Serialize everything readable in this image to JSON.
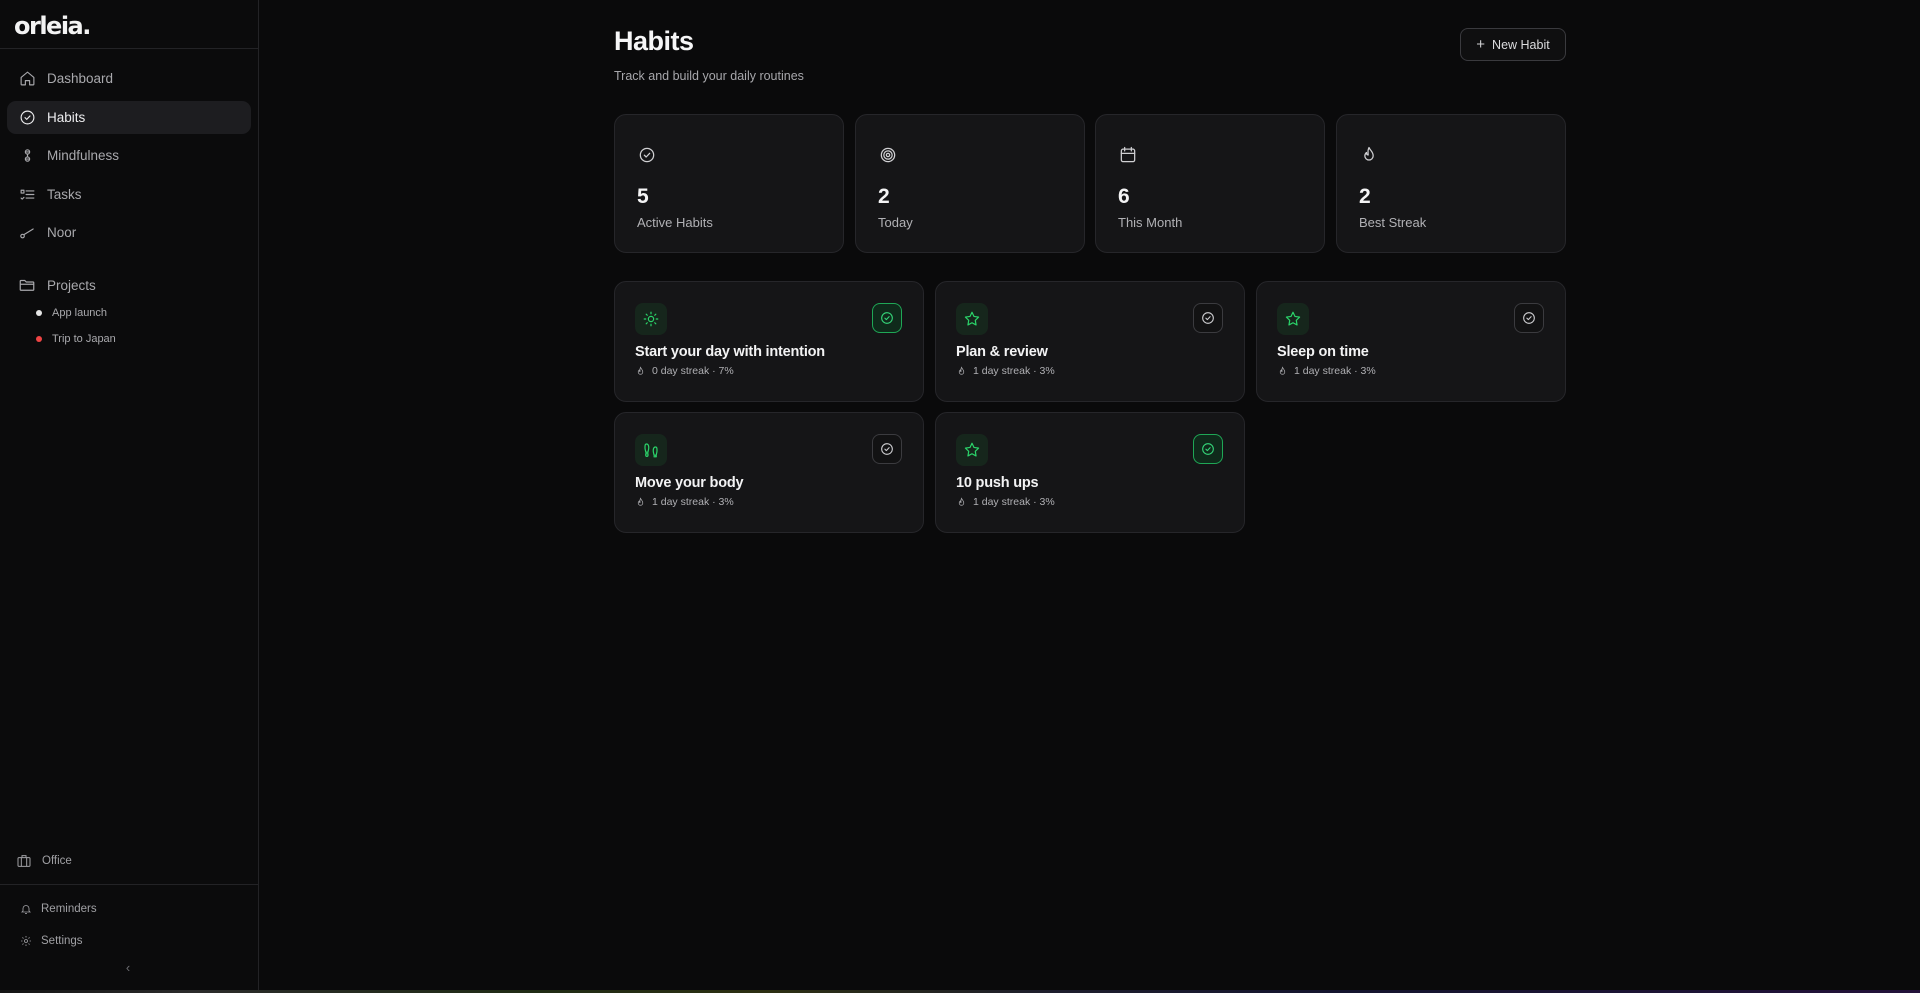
{
  "app": {
    "brand": "orleia."
  },
  "sidebar": {
    "items": [
      {
        "label": "Dashboard",
        "icon": "home-icon"
      },
      {
        "label": "Habits",
        "icon": "check-circle-icon",
        "active": true
      },
      {
        "label": "Mindfulness",
        "icon": "lotus-icon"
      },
      {
        "label": "Tasks",
        "icon": "list-icon"
      },
      {
        "label": "Noor",
        "icon": "wand-icon"
      }
    ],
    "projects_label": "Projects",
    "projects": [
      {
        "label": "App launch",
        "color": "#e5e5e5"
      },
      {
        "label": "Trip to Japan",
        "color": "#ef4444"
      }
    ],
    "office_label": "Office",
    "reminders_label": "Reminders",
    "settings_label": "Settings",
    "collapse_glyph": "‹"
  },
  "header": {
    "title": "Habits",
    "subtitle": "Track and build your daily routines",
    "new_button": "New Habit"
  },
  "stats": [
    {
      "value": "5",
      "label": "Active Habits",
      "icon": "check-circle-icon"
    },
    {
      "value": "2",
      "label": "Today",
      "icon": "target-icon"
    },
    {
      "value": "6",
      "label": "This Month",
      "icon": "calendar-icon"
    },
    {
      "value": "2",
      "label": "Best Streak",
      "icon": "flame-icon"
    }
  ],
  "habits": [
    {
      "title": "Start your day with intention",
      "meta": "0 day streak · 7%",
      "icon": "sun-icon",
      "done": true
    },
    {
      "title": "Plan & review",
      "meta": "1 day streak · 3%",
      "icon": "star-icon",
      "done": false
    },
    {
      "title": "Sleep on time",
      "meta": "1 day streak · 3%",
      "icon": "star-icon",
      "done": false
    },
    {
      "title": "Move your body",
      "meta": "1 day streak · 3%",
      "icon": "footprints-icon",
      "done": false
    },
    {
      "title": "10 push ups",
      "meta": "1 day streak · 3%",
      "icon": "star-icon",
      "done": true
    }
  ],
  "colors": {
    "accent": "#2bd46a",
    "background": "#0a0a0b",
    "card": "#151517"
  }
}
